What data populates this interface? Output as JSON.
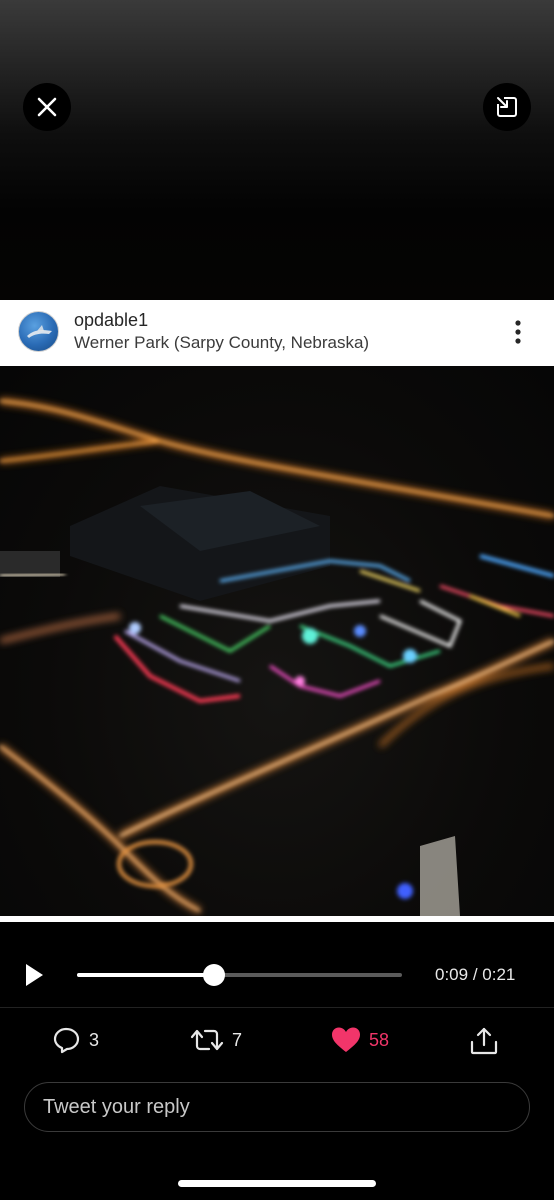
{
  "viewer": {
    "close_icon": "close-icon",
    "minimize_icon": "minimize-icon"
  },
  "post": {
    "username": "opdable1",
    "location": "Werner Park (Sarpy County, Nebraska)",
    "more_icon": "more-vertical-icon"
  },
  "player": {
    "progress": 0.42,
    "time_current": "0:09",
    "time_separator": "/",
    "time_total": "0:21"
  },
  "actions": {
    "replies": "3",
    "retweets": "7",
    "likes": "58",
    "like_color": "#f2356a",
    "share_icon": "share-icon"
  },
  "reply": {
    "placeholder": "Tweet your reply"
  }
}
